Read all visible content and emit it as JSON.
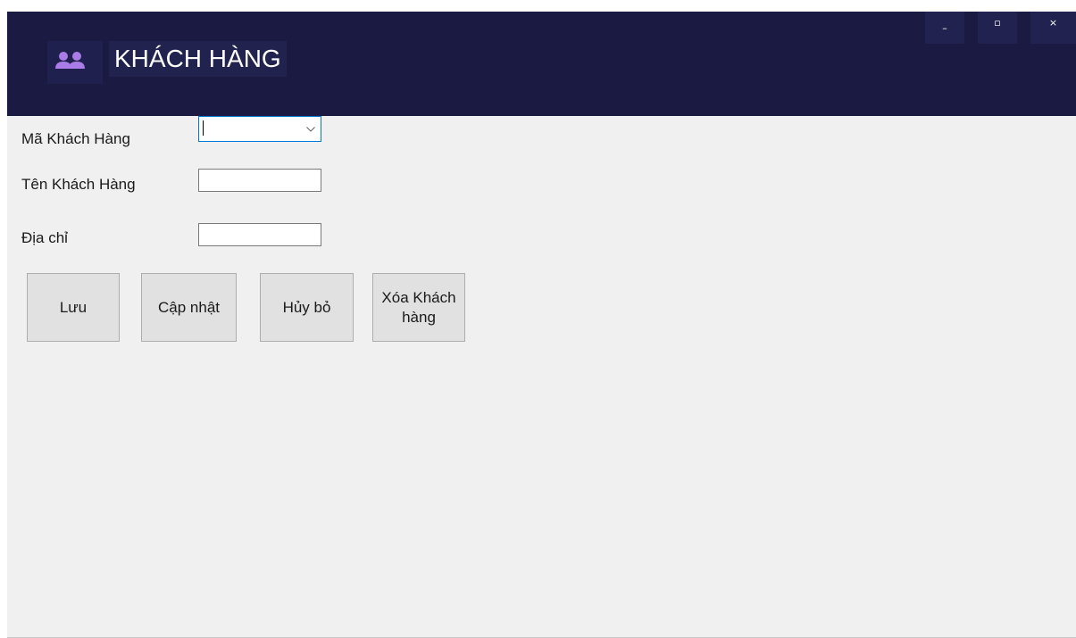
{
  "window": {
    "title": "KHÁCH HÀNG",
    "icon": "users-icon",
    "controls": {
      "minimize_glyph": "–",
      "maximize_glyph": "▫",
      "close_glyph": "×"
    }
  },
  "form": {
    "ma_khach_hang": {
      "label": "Mã Khách Hàng",
      "value": ""
    },
    "ten_khach_hang": {
      "label": "Tên Khách Hàng",
      "value": ""
    },
    "dia_chi": {
      "label": "Địa chỉ",
      "value": ""
    }
  },
  "buttons": {
    "save": "Lưu",
    "update": "Cập nhật",
    "cancel": "Hủy bỏ",
    "delete": "Xóa Khách hàng"
  },
  "colors": {
    "titlebar": "#1a1a42",
    "accent_icon": "#a97ce8",
    "form_background": "#f0f0f0",
    "focus_border": "#0078d7"
  }
}
